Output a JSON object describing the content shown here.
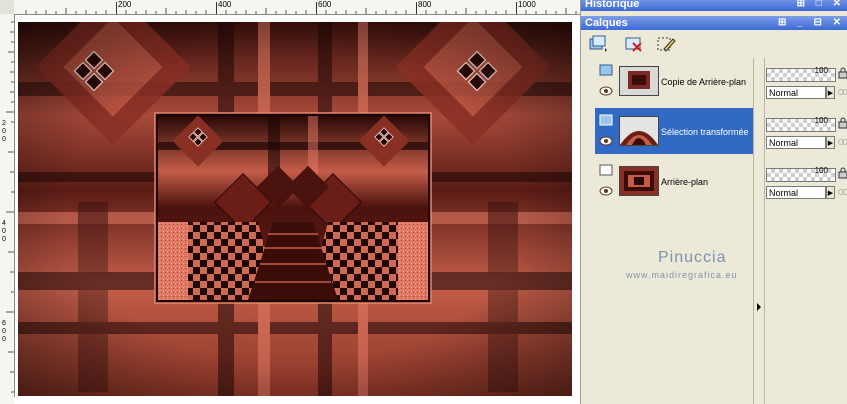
{
  "canvas": {
    "ruler_top_labels": [
      "200",
      "400",
      "600",
      "800",
      "1000"
    ],
    "ruler_left_labels": [
      "2",
      "0",
      "0",
      "4",
      "0",
      "0",
      "6",
      "0",
      "0"
    ],
    "image_colors": {
      "primary": "#c65a48",
      "dark": "#1f0706",
      "mid": "#7a2a22",
      "light": "#e27c66"
    }
  },
  "panels": {
    "history": {
      "title": "Historique"
    },
    "layers": {
      "title": "Calques",
      "title_icons": "⊞ _ ⊟ ✕",
      "toolbar": [
        {
          "icon": "new-layer-icon"
        },
        {
          "icon": "delete-layer-icon"
        },
        {
          "icon": "edit-selection-icon"
        }
      ],
      "items": [
        {
          "name": "Copie de Arrière-plan",
          "opacity": "100",
          "blend": "Normal",
          "selected": false
        },
        {
          "name": "Sélection transformée",
          "opacity": "100",
          "blend": "Normal",
          "selected": true
        },
        {
          "name": "Arrière-plan",
          "opacity": "100",
          "blend": "Normal",
          "selected": false
        }
      ]
    }
  },
  "watermark": {
    "name": "Pinuccia",
    "url": "www.maidiregrafica.eu"
  }
}
